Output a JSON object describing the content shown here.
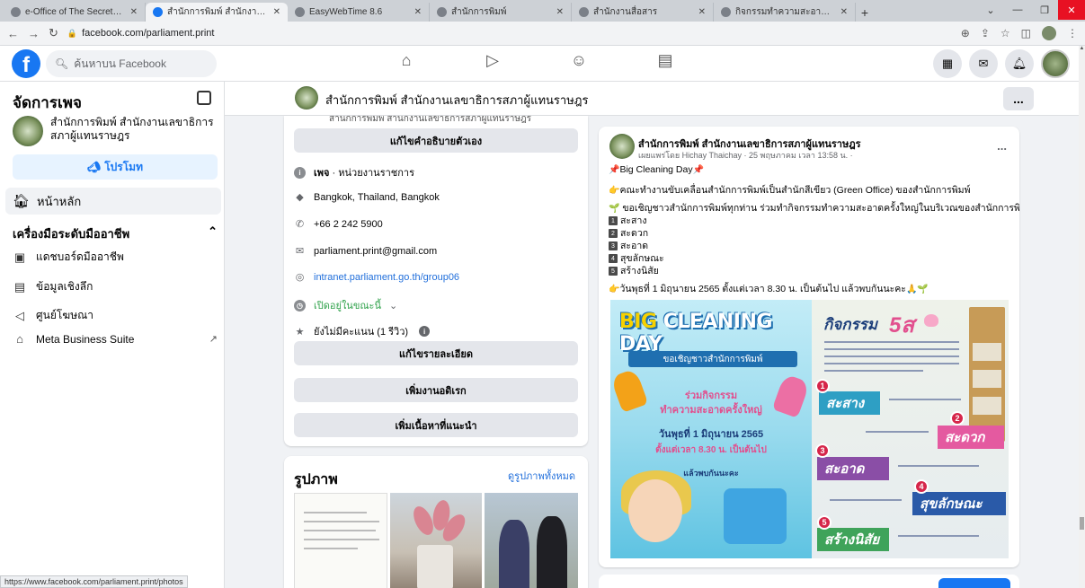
{
  "browser": {
    "tabs": [
      {
        "title": "e-Office of The Secretariat of The",
        "active": false
      },
      {
        "title": "สำนักการพิมพ์ สำนักงานเลขาธิการสภ",
        "active": true
      },
      {
        "title": "EasyWebTime 8.6",
        "active": false
      },
      {
        "title": "สำนักการพิมพ์",
        "active": false
      },
      {
        "title": "สำนักงานสื่อสาร",
        "active": false
      },
      {
        "title": "กิจกรรมทำความสะอาดครั้งใหญ่ (Big C",
        "active": false
      }
    ],
    "url": "facebook.com/parliament.print",
    "status_url": "https://www.facebook.com/parliament.print/photos"
  },
  "fb": {
    "search_placeholder": "ค้นหาบน Facebook"
  },
  "sidebar": {
    "title": "จัดการเพจ",
    "page_name": "สำนักการพิมพ์ สำนักงานเลขาธิการ สภาผู้แทนราษฎร",
    "promote": "โปรโมท",
    "home": "หน้าหลัก",
    "section": "เครื่องมือระดับมืออาชีพ",
    "items": [
      {
        "label": "แดชบอร์ดมืออาชีพ"
      },
      {
        "label": "ข้อมูลเชิงลึก"
      },
      {
        "label": "ศูนย์โฆษณา"
      },
      {
        "label": "Meta Business Suite"
      }
    ]
  },
  "page_header": {
    "name": "สำนักการพิมพ์ สำนักงานเลขาธิการสภาผู้แทนราษฎร",
    "more": "..."
  },
  "intro": {
    "cut_text": "สำนักการพิมพ์ สำนักงานเลขาธิการสภาผู้แทนราษฎร",
    "edit_bio": "แก้ไขคำอธิบายตัวเอง",
    "category_label": "เพจ",
    "category_value": " · หน่วยงานราชการ",
    "location": "Bangkok, Thailand, Bangkok",
    "phone": "+66 2 242 5900",
    "email": "parliament.print@gmail.com",
    "website": "intranet.parliament.go.th/group06",
    "open_now": "เปิดอยู่ในขณะนี้",
    "rating": "ยังไม่มีคะแนน (1 รีวิว)",
    "edit_details": "แก้ไขรายละเอียด",
    "add_hobbies": "เพิ่มงานอดิเรก",
    "add_featured": "เพิ่มเนื้อหาที่แนะนำ"
  },
  "photos": {
    "title": "รูปภาพ",
    "see_all": "ดูรูปภาพทั้งหมด"
  },
  "post": {
    "author": "สำนักการพิมพ์ สำนักงานเลขาธิการสภาผู้แทนราษฎร",
    "meta": "เผยแพร่โดย Hichay Thaichay · 25 พฤษภาคม เวลา 13:58 น. ·",
    "more": "...",
    "line1": "Big Cleaning Day",
    "line2": "คณะทำงานขับเคลื่อนสำนักการพิมพ์เป็นสำนักสีเขียว (Green Office) ของสำนักการพิมพ์",
    "line3": "ขอเชิญชาวสำนักการพิมพ์ทุกท่าน ร่วมทำกิจกรรมทำความสะอาดครั้งใหญ่ในบริเวณของสำนักการพิมพ์",
    "items": [
      "สะสาง",
      "สะดวก",
      "สะอาด",
      "สุขลักษณะ",
      "สร้างนิสัย"
    ],
    "line_date": "วันพุธที่ 1 มิถุนายน 2565 ตั้งแต่เวลา 8.30 น. เป็นต้นไป แล้วพบกันนะคะ"
  },
  "poster_left": {
    "title_a": "BIG ",
    "title_b": "CLEANING DAY",
    "invite": "ขอเชิญชาวสำนักการพิมพ์",
    "act1": "ร่วมกิจกรรม",
    "act2": "ทำความสะอาดครั้งใหญ่",
    "act3": "วันพุธที่ 1 มิถุนายน 2565",
    "act4": "ตั้งแต่เวลา 8.30 น. เป็นต้นไป",
    "act5": "แล้วพบกันนะคะ"
  },
  "poster_right": {
    "title": "กิจกรรม",
    "five_s": "5ส",
    "steps": [
      {
        "num": "1",
        "label": "สะสาง"
      },
      {
        "num": "2",
        "label": "สะดวก"
      },
      {
        "num": "3",
        "label": "สะอาด"
      },
      {
        "num": "4",
        "label": "สุขลักษณะ"
      },
      {
        "num": "5",
        "label": "สร้างนิสัย"
      }
    ]
  },
  "colors": {
    "fb_blue": "#1877f2",
    "link": "#216fdb",
    "open_green": "#31a24c"
  }
}
